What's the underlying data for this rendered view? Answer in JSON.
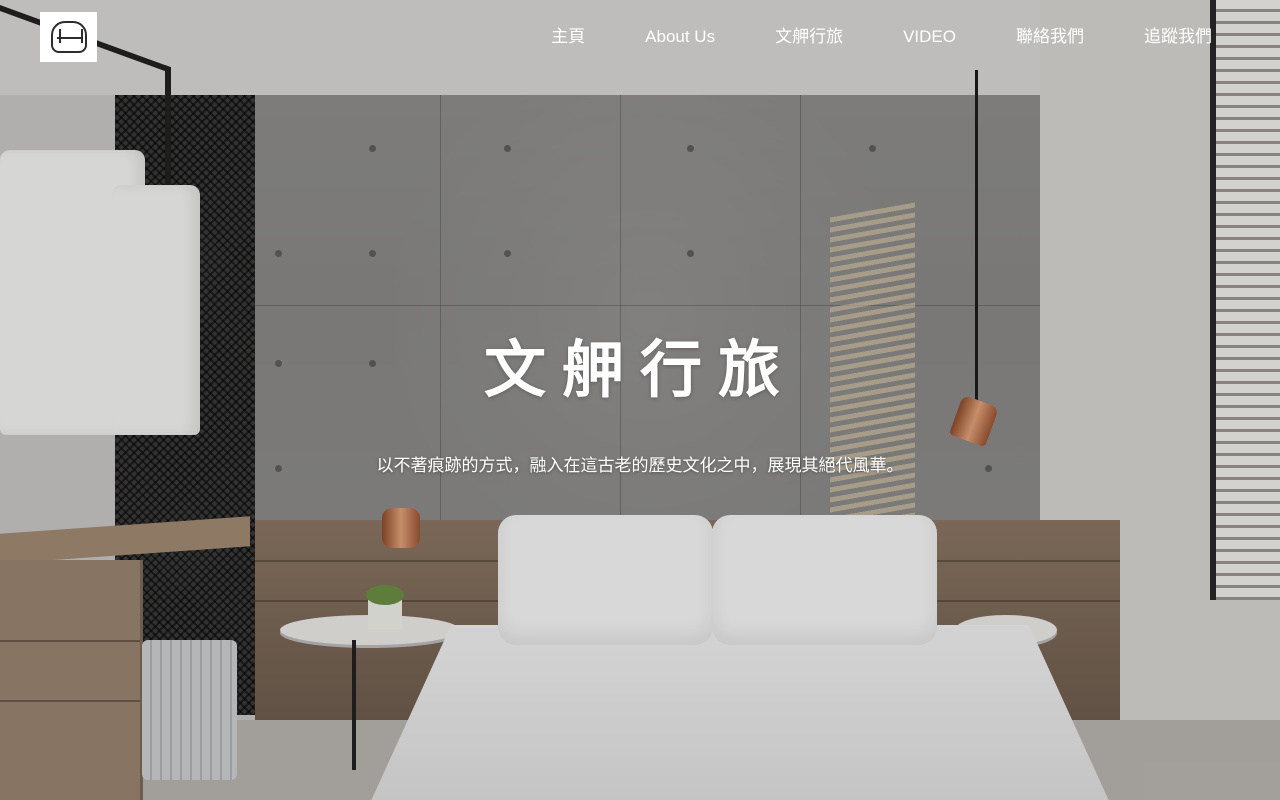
{
  "header": {
    "logo_alt": "文舺行旅 logo",
    "nav": [
      {
        "label": "主頁"
      },
      {
        "label": "About Us"
      },
      {
        "label": "文舺行旅"
      },
      {
        "label": "VIDEO"
      },
      {
        "label": "聯絡我們"
      },
      {
        "label": "追蹤我們"
      }
    ]
  },
  "hero": {
    "title": "文舺行旅",
    "subtitle": "以不著痕跡的方式，融入在這古老的歷史文化之中，展現其絕代風華。"
  },
  "colors": {
    "nav_text": "#ffffff",
    "logo_bg": "#ffffff",
    "wall": "#8c8b89"
  }
}
